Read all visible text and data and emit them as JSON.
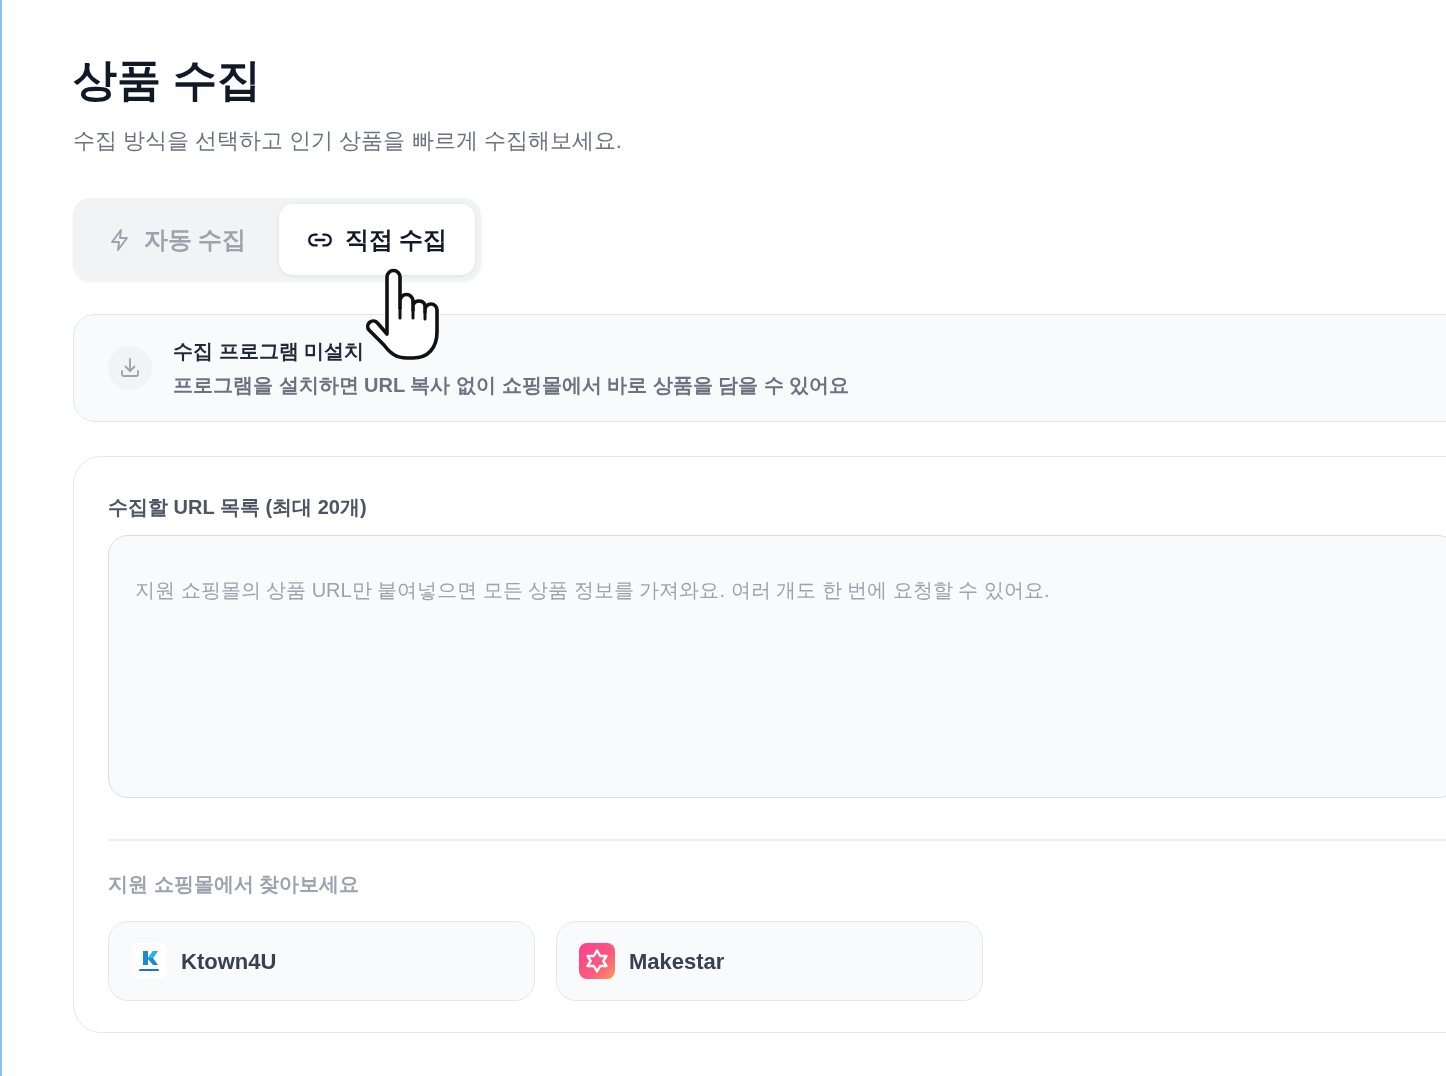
{
  "page": {
    "title": "상품 수집",
    "subtitle": "수집 방식을 선택하고 인기 상품을 빠르게 수집해보세요."
  },
  "tabs": [
    {
      "label": "자동 수집",
      "selected": false
    },
    {
      "label": "직접 수집",
      "selected": true
    }
  ],
  "install_notice": {
    "title": "수집 프로그램 미설치",
    "description": "프로그램을 설치하면 URL 복사 없이 쇼핑몰에서 바로 상품을 담을 수 있어요"
  },
  "url_form": {
    "label": "수집할 URL 목록 (최대 20개)",
    "textarea": {
      "placeholder": "지원 쇼핑몰의 상품 URL만 붙여넣으면 모든 상품 정보를 가져와요. 여러 개도 한 번에 요청할 수 있어요."
    }
  },
  "shops": {
    "heading": "지원 쇼핑몰에서 찾아보세요",
    "items": [
      {
        "name": "Ktown4U"
      },
      {
        "name": "Makestar"
      }
    ]
  }
}
